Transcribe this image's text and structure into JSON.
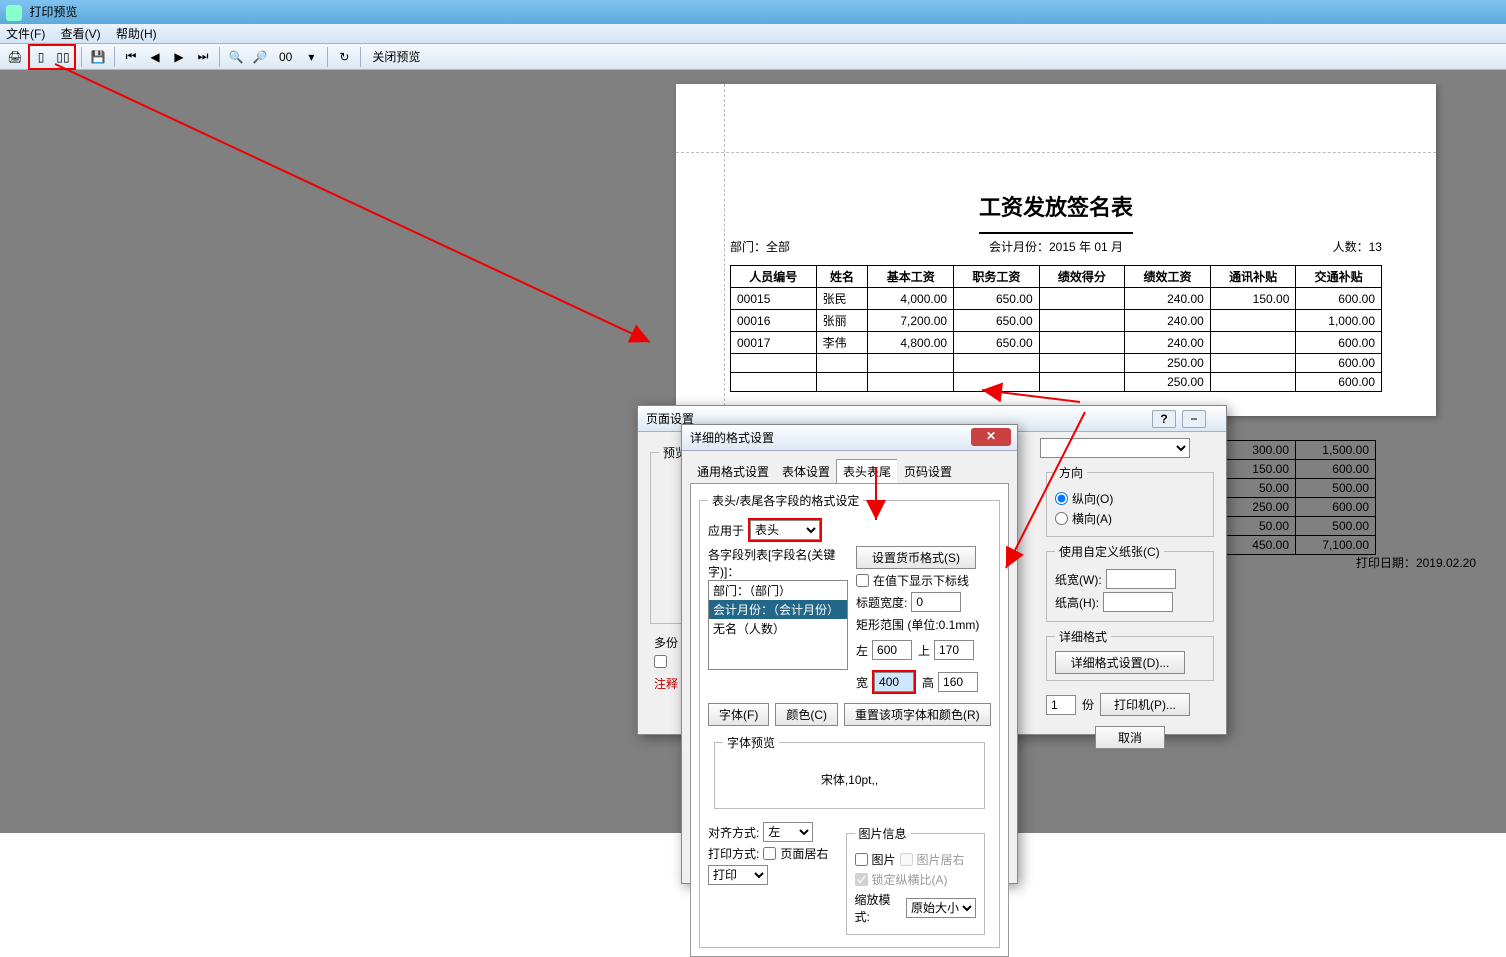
{
  "window": {
    "title": "打印预览"
  },
  "menu": {
    "file": "文件(F)",
    "view": "查看(V)",
    "help": "帮助(H)"
  },
  "toolbar": {
    "zoom_text": "00",
    "close_preview": "关闭预览"
  },
  "doc": {
    "title": "工资发放签名表",
    "dept_label": "部门：",
    "dept_value": "全部",
    "period_label": "会计月份：",
    "period_value": "2015 年 01 月",
    "count_label": "人数：",
    "count_value": "13",
    "print_date_label": "打印日期：",
    "print_date_value": "2019.02.20",
    "columns": [
      "人员编号",
      "姓名",
      "基本工资",
      "职务工资",
      "绩效得分",
      "绩效工资",
      "通讯补贴",
      "交通补贴"
    ],
    "rows": [
      {
        "id": "00015",
        "name": "张民",
        "base": "4,000.00",
        "duty": "650.00",
        "score": "",
        "perf": "240.00",
        "comm": "150.00",
        "trans": "600.00"
      },
      {
        "id": "00016",
        "name": "张丽",
        "base": "7,200.00",
        "duty": "650.00",
        "score": "",
        "perf": "240.00",
        "comm": "",
        "trans": "1,000.00"
      },
      {
        "id": "00017",
        "name": "李伟",
        "base": "4,800.00",
        "duty": "650.00",
        "score": "",
        "perf": "240.00",
        "comm": "",
        "trans": "600.00"
      },
      {
        "id": "",
        "name": "",
        "base": "",
        "duty": "",
        "score": "",
        "perf": "250.00",
        "comm": "",
        "trans": "600.00"
      },
      {
        "id": "",
        "name": "",
        "base": "",
        "duty": "",
        "score": "",
        "perf": "250.00",
        "comm": "",
        "trans": "600.00"
      }
    ],
    "extra_right_rows": [
      [
        "300.00",
        "1,500.00"
      ],
      [
        "150.00",
        "600.00"
      ],
      [
        "50.00",
        "500.00"
      ],
      [
        "250.00",
        "600.00"
      ],
      [
        "50.00",
        "500.00"
      ],
      [
        "450.00",
        "7,100.00"
      ]
    ]
  },
  "page_setup": {
    "title": "页面设置",
    "preview_group": "预览",
    "multi_label": "多份",
    "note_prefix": "注释",
    "direction_group": "方向",
    "portrait": "纵向(O)",
    "landscape": "横向(A)",
    "custom_paper_group": "使用自定义纸张(C)",
    "paper_w": "纸宽(W):",
    "paper_h": "纸高(H):",
    "detail_group": "详细格式",
    "detail_btn": "详细格式设置(D)...",
    "copies_value": "1",
    "copies_unit": "份",
    "printer_btn": "打印机(P)...",
    "cancel": "取消",
    "help": "?",
    "min": "⎯"
  },
  "detail": {
    "title": "详细的格式设置",
    "tab1": "通用格式设置",
    "tab2": "表体设置",
    "tab3": "表头表尾",
    "tab4": "页码设置",
    "header_footer_fields": "表头/表尾各字段的格式设定",
    "apply_to": "应用于",
    "apply_to_value": "表头",
    "field_list_label": "各字段列表[字段名(关键字)]：",
    "currency_btn": "设置货币格式(S)",
    "list_item1": "部门：（部门）",
    "list_item2": "会计月份：（会计月份）",
    "list_item3": "无名（人数）",
    "underline": "在值下显示下标线",
    "title_width": "标题宽度:",
    "title_width_value": "0",
    "rect_range": "矩形范围 (单位:0.1mm)",
    "left": "左",
    "left_value": "600",
    "top": "上",
    "top_value": "170",
    "width": "宽",
    "width_value": "400",
    "height": "高",
    "height_value": "160",
    "font_btn": "字体(F)",
    "color_btn": "颜色(C)",
    "reset_btn": "重置该项字体和颜色(R)",
    "font_preview_group": "字体预览",
    "font_preview_text": "宋体,10pt,,",
    "align_label": "对齐方式:",
    "align_value": "左",
    "print_mode_label": "打印方式:",
    "page_center": "页面居右",
    "print_opt": "打印",
    "image_group": "图片信息",
    "image_chk": "图片",
    "image_right": "图片居右",
    "lock_ratio": "锁定纵横比(A)",
    "zoom_mode": "缩放模式:",
    "zoom_value": "原始大小"
  }
}
